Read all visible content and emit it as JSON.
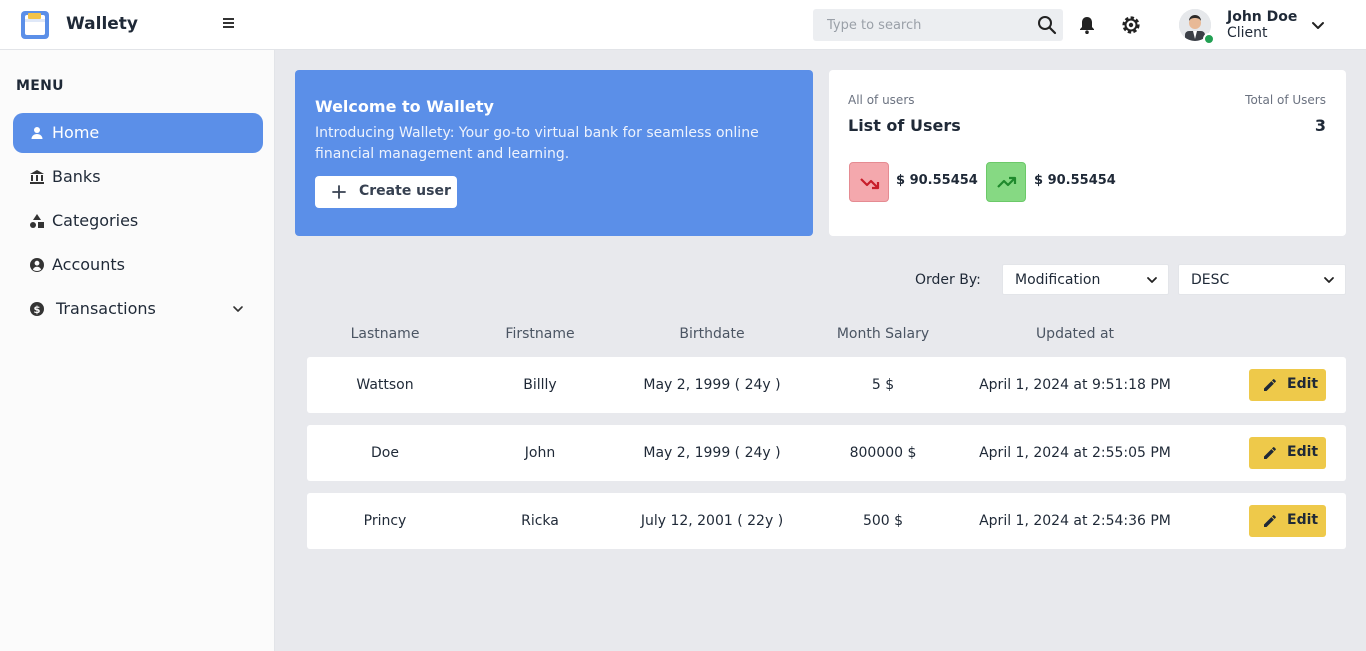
{
  "header": {
    "app_name": "Wallety",
    "search_placeholder": "Type to search",
    "user": {
      "name": "John Doe",
      "role": "Client",
      "status": "online"
    },
    "icons": [
      "wallet-logo-icon",
      "menu-icon",
      "search-icon",
      "bell-icon",
      "gear-icon",
      "chevron-down-icon"
    ]
  },
  "sidebar": {
    "title": "MENU",
    "items": [
      {
        "label": "Home",
        "icon": "user-icon",
        "active": true
      },
      {
        "label": "Banks",
        "icon": "bank-icon"
      },
      {
        "label": "Categories",
        "icon": "shapes-icon"
      },
      {
        "label": "Accounts",
        "icon": "account-circle-icon"
      },
      {
        "label": "Transactions",
        "icon": "dollar-coin-icon",
        "has_submenu": true
      }
    ]
  },
  "welcome": {
    "title": "Welcome to Wallety",
    "text": "Introducing Wallety: Your go-to virtual bank for seamless online financial management and learning.",
    "button": "Create user"
  },
  "stats": {
    "subtitle": "All of users",
    "title": "List of Users",
    "total_label": "Total of Users",
    "total": "3",
    "down_value": "$ 90.55454",
    "up_value": "$ 90.55454"
  },
  "order": {
    "label": "Order By:",
    "field": "Modification",
    "direction": "DESC"
  },
  "table": {
    "headers": [
      "Lastname",
      "Firstname",
      "Birthdate",
      "Month Salary",
      "Updated at"
    ],
    "edit_label": "Edit",
    "rows": [
      {
        "lastname": "Wattson",
        "firstname": "Billly",
        "birthdate": "May 2, 1999 ( 24y )",
        "salary": "5 $",
        "updated": "April 1, 2024 at 9:51:18 PM"
      },
      {
        "lastname": "Doe",
        "firstname": "John",
        "birthdate": "May 2, 1999 ( 24y )",
        "salary": "800000 $",
        "updated": "April 1, 2024 at 2:55:05 PM"
      },
      {
        "lastname": "Princy",
        "firstname": "Ricka",
        "birthdate": "July 12, 2001 ( 22y )",
        "salary": "500 $",
        "updated": "April 1, 2024 at 2:54:36 PM"
      }
    ]
  },
  "colors": {
    "primary": "#5b8fe8",
    "edit_button": "#eec94a",
    "trend_down_bg": "#f4a8ad",
    "trend_up_bg": "#86d983",
    "online": "#22a053"
  }
}
